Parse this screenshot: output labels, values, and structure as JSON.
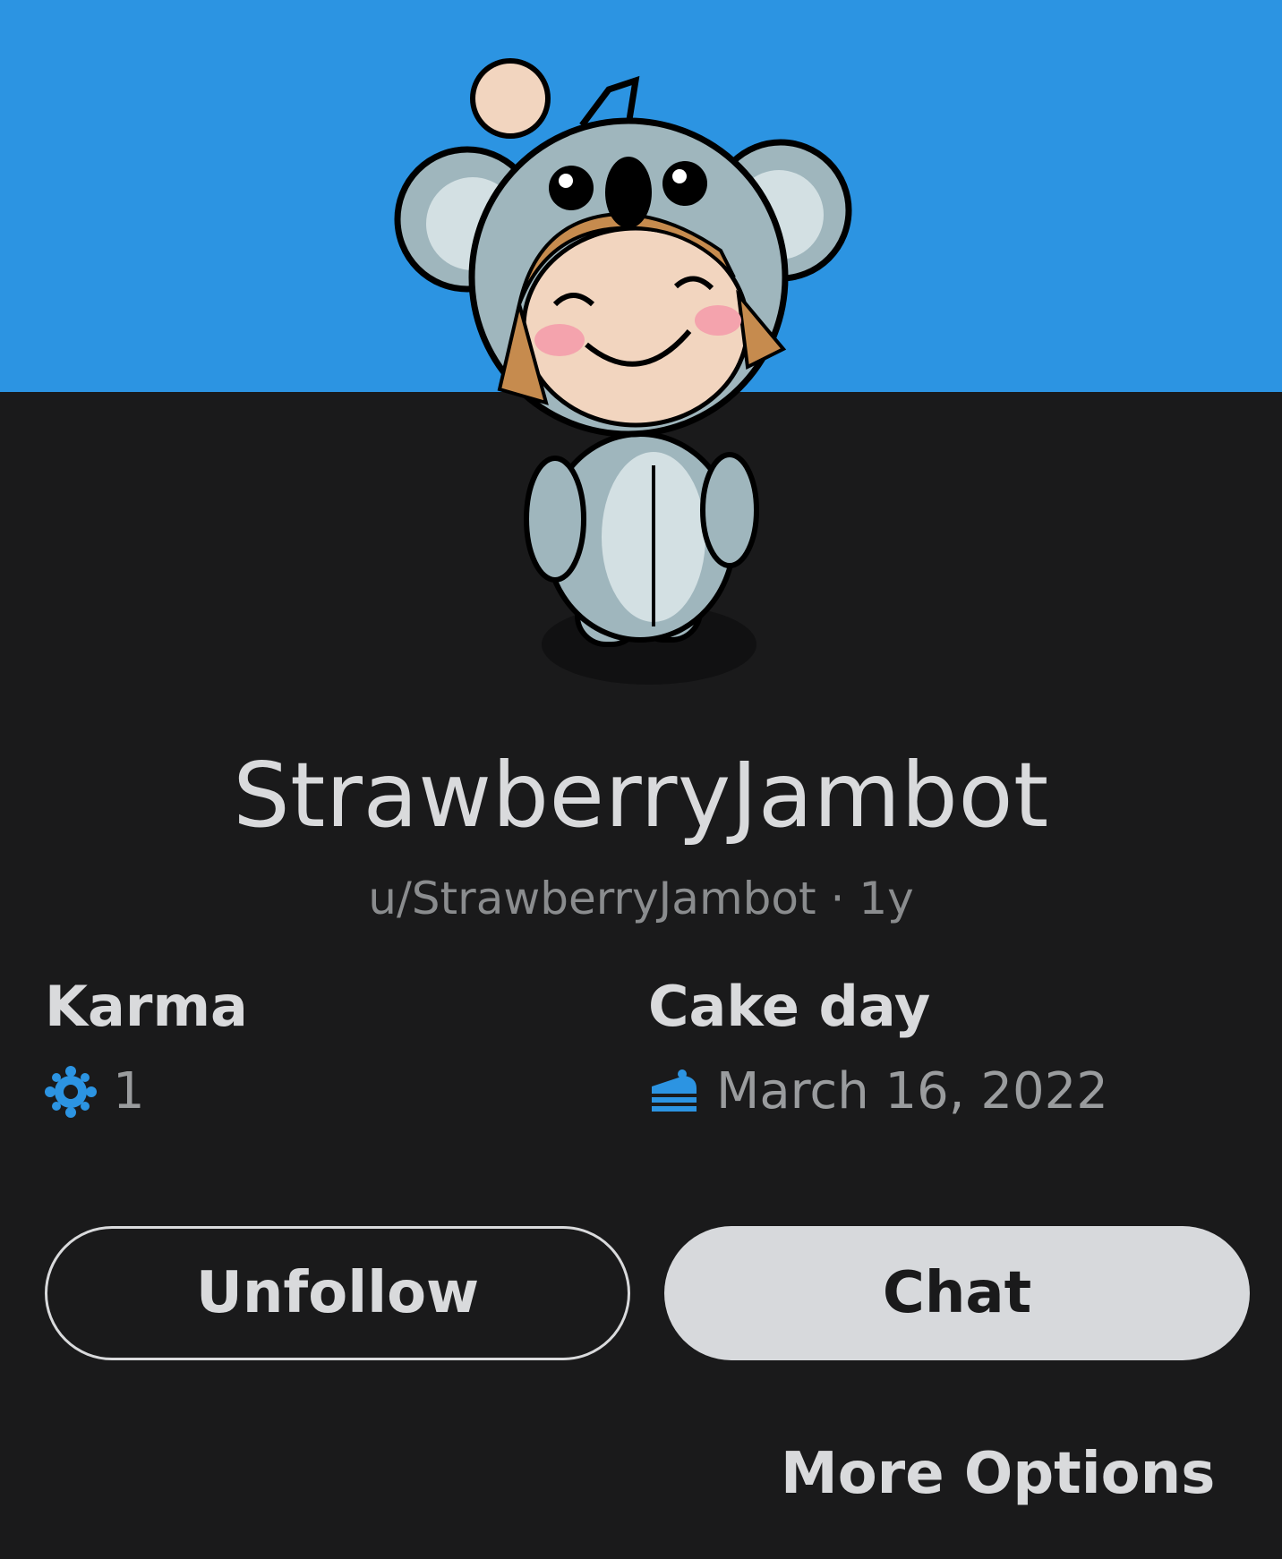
{
  "profile": {
    "display_name": "StrawberryJambot",
    "username": "u/StrawberryJambot",
    "age": "1y",
    "separator": "·",
    "avatar_icon": "koala-snoo-avatar"
  },
  "stats": {
    "karma_label": "Karma",
    "karma_value": "1",
    "karma_icon": "karma-icon",
    "cakeday_label": "Cake day",
    "cakeday_value": "March 16, 2022",
    "cakeday_icon": "cake-icon"
  },
  "actions": {
    "unfollow_label": "Unfollow",
    "chat_label": "Chat",
    "more_options_label": "More Options"
  },
  "colors": {
    "banner": "#2c94e2",
    "background": "#1a1a1b",
    "accent_icon": "#2c94e2",
    "chat_button": "#d7d9dc"
  }
}
